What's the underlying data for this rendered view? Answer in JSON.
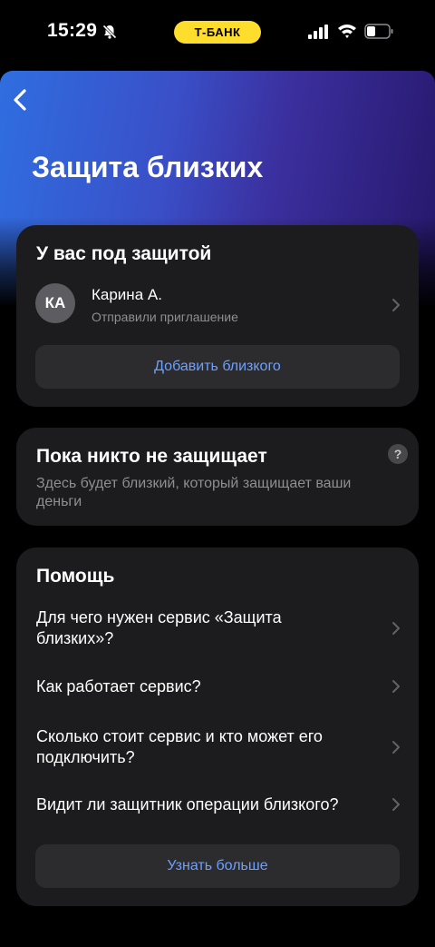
{
  "status_bar": {
    "time": "15:29",
    "carrier": "Т-БАНК"
  },
  "header": {
    "title": "Защита близких"
  },
  "protected": {
    "heading": "У вас под защитой",
    "person": {
      "initials": "КА",
      "name": "Карина А.",
      "status": "Отправили приглашение"
    },
    "add_button": "Добавить близкого"
  },
  "guardians": {
    "heading": "Пока никто не защищает",
    "help_badge": "?",
    "description": "Здесь будет близкий, который защищает ваши деньги"
  },
  "help": {
    "heading": "Помощь",
    "items": [
      {
        "label": "Для чего нужен сервис «Защита близких»?"
      },
      {
        "label": "Как работает сервис?"
      },
      {
        "label": "Сколько стоит сервис и кто может его подключить?"
      },
      {
        "label": "Видит ли защитник операции близкого?"
      }
    ],
    "more_button": "Узнать больше"
  },
  "colors": {
    "accent_link": "#6ca0ff",
    "carrier_badge": "#ffdd2d",
    "card_bg": "#1c1c1e",
    "button_bg": "#2c2c2e"
  }
}
